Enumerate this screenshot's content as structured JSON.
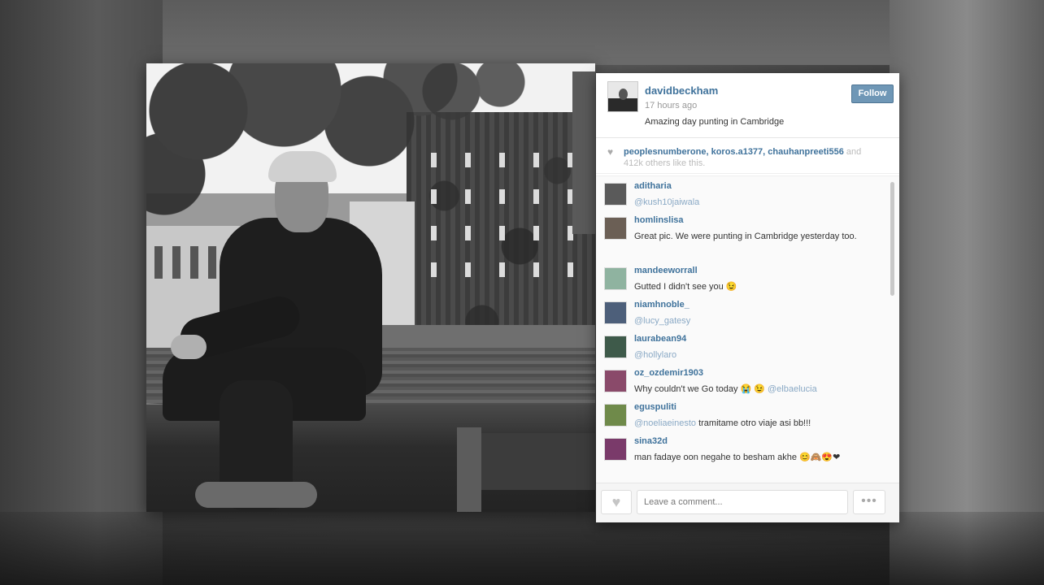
{
  "post": {
    "username": "davidbeckham",
    "time_ago": "17 hours ago",
    "caption": "Amazing day punting in Cambridge",
    "follow_label": "Follow"
  },
  "likes": {
    "likers": "peoplesnumberone, koros.a1377, chauhanpreeti556",
    "and_label": "and",
    "count_text": "412k",
    "suffix": "others like this."
  },
  "comments": [
    {
      "user": "aditharia",
      "text": "",
      "mention": "@kush10jaiwala"
    },
    {
      "user": "homlinslisa",
      "text": "Great pic. We were punting in Cambridge yesterday too.",
      "mention": ""
    },
    {
      "user": "mandeeworrall",
      "text": "Gutted I didn't see you 😉",
      "mention": ""
    },
    {
      "user": "niamhnoble_",
      "text": "",
      "mention": "@lucy_gatesy"
    },
    {
      "user": "laurabean94",
      "text": "",
      "mention": "@hollylaro"
    },
    {
      "user": "oz_ozdemir1903",
      "text": "Why couldn't we Go today 😭 😉",
      "mention": "@elbaelucia"
    },
    {
      "user": "eguspuliti",
      "text": "tramitame otro viaje asi bb!!!",
      "mention": "@noeliaeinesto"
    },
    {
      "user": "sina32d",
      "text": "man fadaye oon negahe to besham akhe 😊🙈😍❤",
      "mention": ""
    }
  ],
  "footer": {
    "comment_placeholder": "Leave a comment...",
    "like_icon": "heart-icon",
    "more_label": "•••"
  }
}
